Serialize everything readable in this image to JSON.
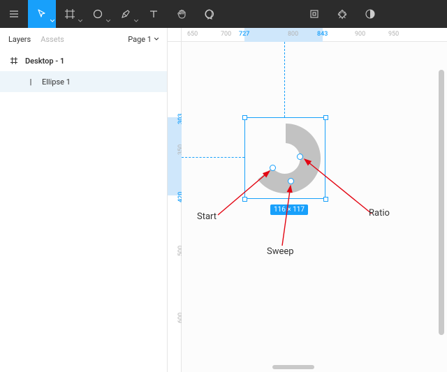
{
  "toolbar": {
    "tools": [
      "menu",
      "move",
      "frame",
      "shape",
      "pen",
      "text",
      "hand",
      "comment"
    ],
    "right_tools": [
      "components",
      "effects",
      "mask"
    ]
  },
  "sidebar": {
    "tabs": {
      "layers": "Layers",
      "assets": "Assets"
    },
    "page_selector": "Page 1",
    "frame": {
      "name": "Desktop - 1"
    },
    "layers": [
      {
        "name": "Ellipse 1",
        "selected": true
      }
    ]
  },
  "ruler": {
    "h_ticks": [
      "650",
      "700",
      "727",
      "800",
      "843",
      "900",
      "950"
    ],
    "h_active": [
      "727",
      "843"
    ],
    "v_ticks": [
      "303",
      "350",
      "420",
      "500",
      "600"
    ],
    "v_active": [
      "303",
      "420"
    ]
  },
  "selection": {
    "dimensions": "116 × 117"
  },
  "annotations": {
    "start": "Start",
    "sweep": "Sweep",
    "ratio": "Ratio"
  },
  "colors": {
    "accent": "#18a0fb",
    "toolbar_bg": "#2c2c2c",
    "shape_fill": "#c2c2c2",
    "arrow": "#e30613"
  }
}
